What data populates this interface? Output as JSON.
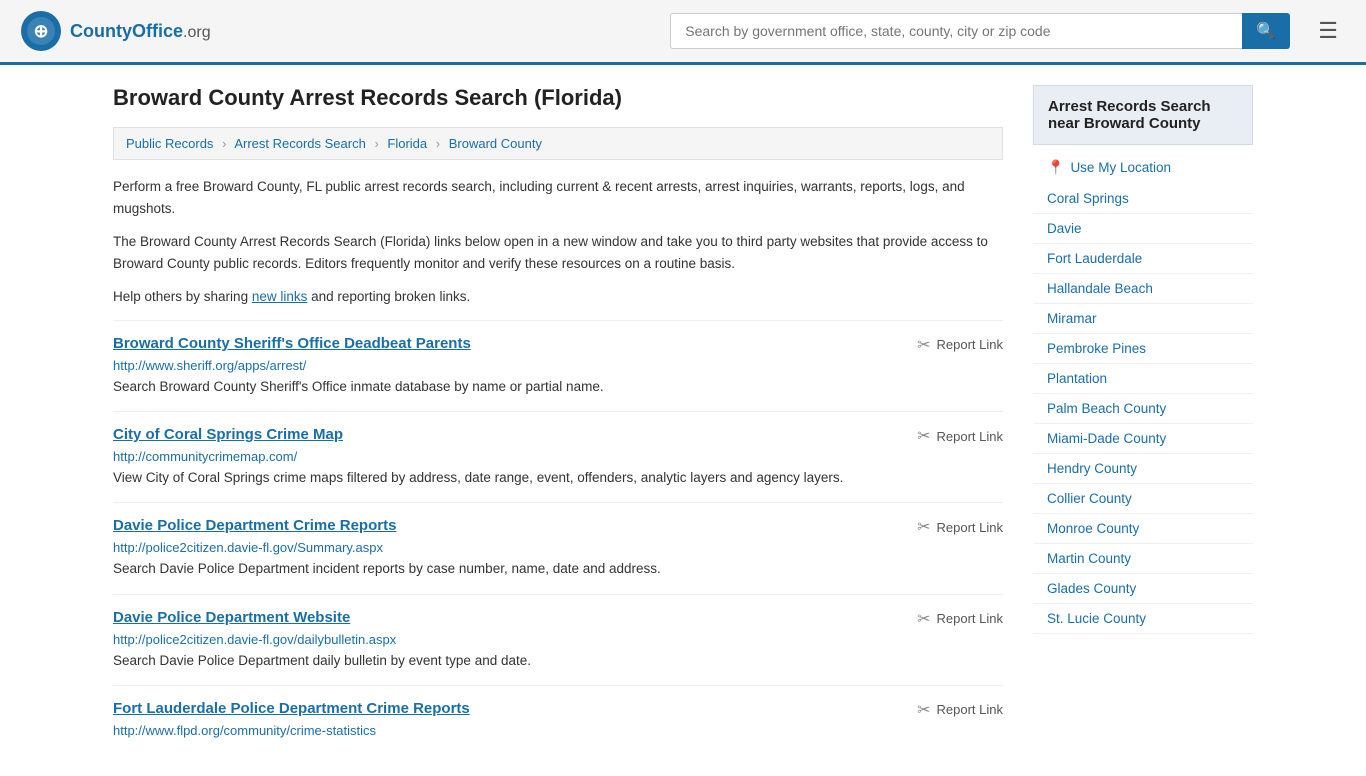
{
  "header": {
    "logo_text": "CountyOffice",
    "logo_ext": ".org",
    "search_placeholder": "Search by government office, state, county, city or zip code"
  },
  "page": {
    "title": "Broward County Arrest Records Search (Florida)"
  },
  "breadcrumb": {
    "items": [
      {
        "label": "Public Records",
        "href": "#"
      },
      {
        "label": "Arrest Records Search",
        "href": "#"
      },
      {
        "label": "Florida",
        "href": "#"
      },
      {
        "label": "Broward County",
        "href": "#"
      }
    ]
  },
  "descriptions": [
    "Perform a free Broward County, FL public arrest records search, including current & recent arrests, arrest inquiries, warrants, reports, logs, and mugshots.",
    "The Broward County Arrest Records Search (Florida) links below open in a new window and take you to third party websites that provide access to Broward County public records. Editors frequently monitor and verify these resources on a routine basis.",
    "Help others by sharing new links and reporting broken links."
  ],
  "results": [
    {
      "title": "Broward County Sheriff's Office Deadbeat Parents",
      "url": "http://www.sheriff.org/apps/arrest/",
      "description": "Search Broward County Sheriff's Office inmate database by name or partial name.",
      "report_label": "Report Link"
    },
    {
      "title": "City of Coral Springs Crime Map",
      "url": "http://communitycrimemap.com/",
      "description": "View City of Coral Springs crime maps filtered by address, date range, event, offenders, analytic layers and agency layers.",
      "report_label": "Report Link"
    },
    {
      "title": "Davie Police Department Crime Reports",
      "url": "http://police2citizen.davie-fl.gov/Summary.aspx",
      "description": "Search Davie Police Department incident reports by case number, name, date and address.",
      "report_label": "Report Link"
    },
    {
      "title": "Davie Police Department Website",
      "url": "http://police2citizen.davie-fl.gov/dailybulletin.aspx",
      "description": "Search Davie Police Department daily bulletin by event type and date.",
      "report_label": "Report Link"
    },
    {
      "title": "Fort Lauderdale Police Department Crime Reports",
      "url": "http://www.flpd.org/community/crime-statistics",
      "description": "",
      "report_label": "Report Link"
    }
  ],
  "sidebar": {
    "header": "Arrest Records Search near Broward County",
    "use_location": "Use My Location",
    "links": [
      "Coral Springs",
      "Davie",
      "Fort Lauderdale",
      "Hallandale Beach",
      "Miramar",
      "Pembroke Pines",
      "Plantation",
      "Palm Beach County",
      "Miami-Dade County",
      "Hendry County",
      "Collier County",
      "Monroe County",
      "Martin County",
      "Glades County",
      "St. Lucie County"
    ]
  }
}
